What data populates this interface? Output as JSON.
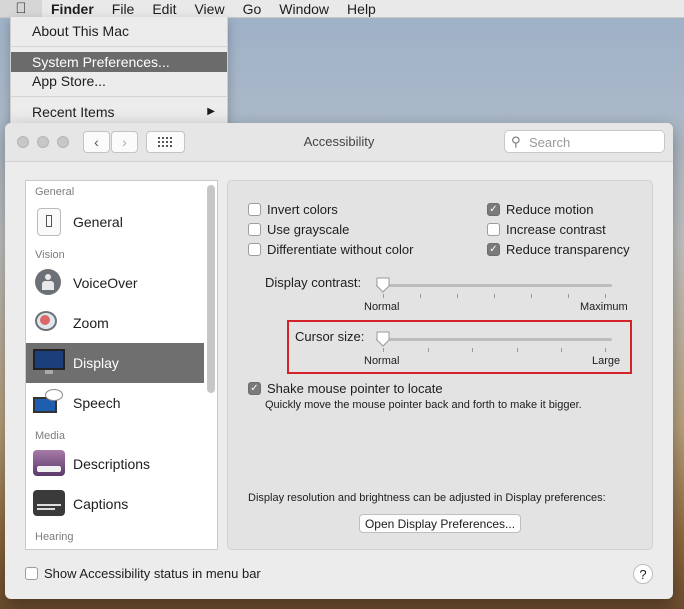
{
  "menubar": {
    "apple_icon": "apple-logo",
    "items": [
      "Finder",
      "File",
      "Edit",
      "View",
      "Go",
      "Window",
      "Help"
    ]
  },
  "apple_menu": {
    "items": [
      {
        "label": "About This Mac"
      },
      {
        "label": "System Preferences..."
      },
      {
        "label": "App Store..."
      },
      {
        "label": "Recent Items",
        "submenu": true
      }
    ],
    "selected": "System Preferences..."
  },
  "window": {
    "title": "Accessibility",
    "search": {
      "placeholder": "Search",
      "value": ""
    },
    "nav": {
      "back": "‹",
      "forward": "›"
    }
  },
  "sidebar": {
    "sections": [
      {
        "label": "General",
        "items": [
          {
            "label": "General",
            "icon": "general-icon"
          }
        ]
      },
      {
        "label": "Vision",
        "items": [
          {
            "label": "VoiceOver",
            "icon": "voiceover-icon"
          },
          {
            "label": "Zoom",
            "icon": "zoom-icon"
          },
          {
            "label": "Display",
            "icon": "display-icon",
            "selected": true
          },
          {
            "label": "Speech",
            "icon": "speech-icon"
          }
        ]
      },
      {
        "label": "Media",
        "items": [
          {
            "label": "Descriptions",
            "icon": "descriptions-icon"
          },
          {
            "label": "Captions",
            "icon": "captions-icon"
          }
        ]
      },
      {
        "label": "Hearing",
        "items": []
      }
    ]
  },
  "display_pane": {
    "options_left": [
      {
        "label": "Invert colors",
        "checked": false
      },
      {
        "label": "Use grayscale",
        "checked": false
      },
      {
        "label": "Differentiate without color",
        "checked": false
      }
    ],
    "options_right": [
      {
        "label": "Reduce motion",
        "checked": true
      },
      {
        "label": "Increase contrast",
        "checked": false
      },
      {
        "label": "Reduce transparency",
        "checked": true
      }
    ],
    "contrast_slider": {
      "label": "Display contrast:",
      "min_label": "Normal",
      "max_label": "Maximum",
      "value": 0
    },
    "cursor_slider": {
      "label": "Cursor size:",
      "min_label": "Normal",
      "max_label": "Large",
      "value": 0
    },
    "shake": {
      "label": "Shake mouse pointer to locate",
      "checked": true,
      "description": "Quickly move the mouse pointer back and forth to make it bigger."
    },
    "resolution_note": "Display resolution and brightness can be adjusted in Display preferences:",
    "open_button": "Open Display Preferences..."
  },
  "footer": {
    "status_checkbox": {
      "label": "Show Accessibility status in menu bar",
      "checked": false
    },
    "help": "?"
  },
  "colors": {
    "highlight": "#d3222a",
    "selected_row": "#6f6f6f"
  }
}
